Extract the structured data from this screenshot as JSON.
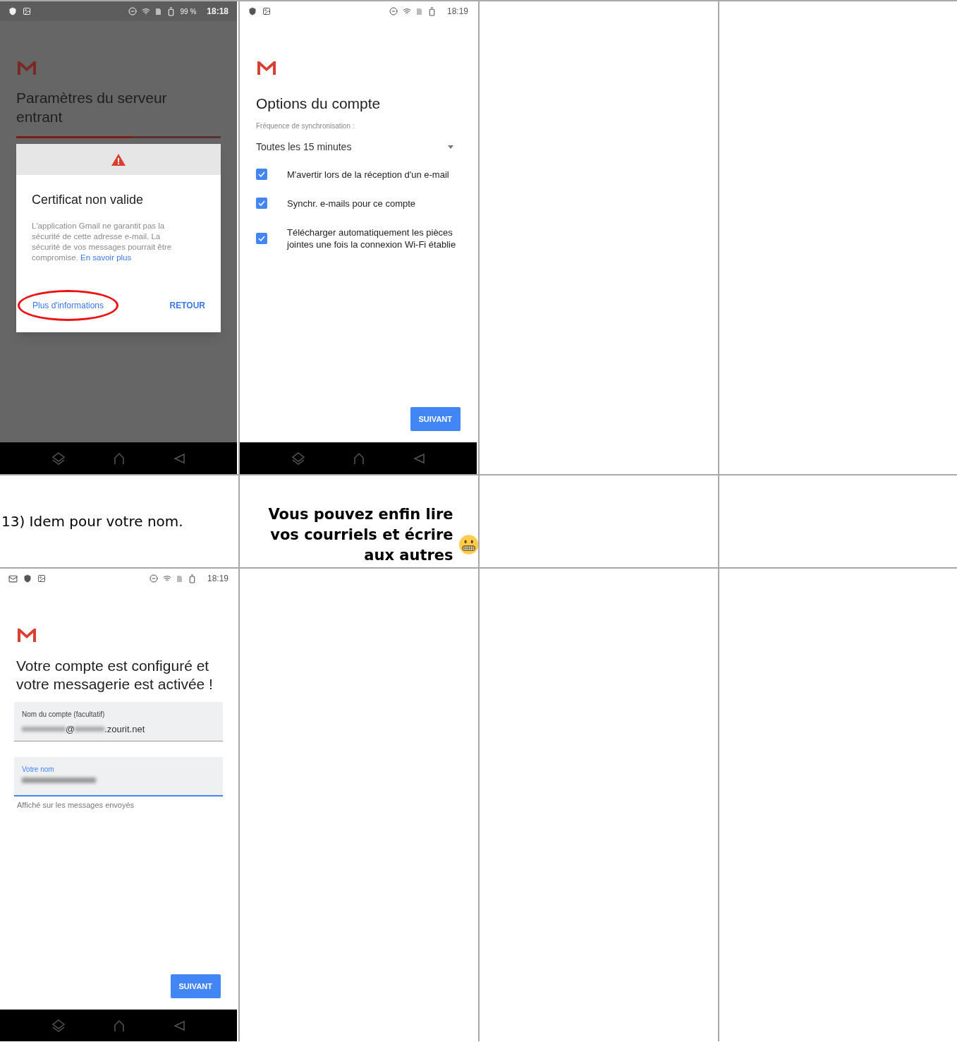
{
  "table": {
    "rows": [
      {
        "cells": [
          {
            "kind": "dialog_screen",
            "status_battery": "99 %",
            "status_time": "18:18",
            "title": "Paramètres du serveur entrant",
            "progress": {
              "level": 0.57
            },
            "dialog": {
              "title": "Certificat non valide",
              "body": "L'application Gmail ne garantit pas la sécurité de cette adresse e-mail. La sécurité de vos messages pourrait être compromise.",
              "link": "En savoir plus",
              "buttons": [
                {
                  "label": "Plus d'informations",
                  "highlighted": true
                },
                {
                  "label": "RETOUR",
                  "highlighted": false
                }
              ]
            }
          },
          {
            "kind": "options_screen",
            "status_time": "18:19",
            "title": "Options du compte",
            "sync_label": "Fréquence de synchronisation :",
            "sync_value": "Toutes les 15 minutes",
            "options": [
              {
                "label": "M'avertir lors de la réception d'un e-mail",
                "checked": true
              },
              {
                "label": "Synchr. e-mails pour ce compte",
                "checked": true
              },
              {
                "label": "Télécharger automatiquement les pièces jointes une fois la connexion Wi-Fi établie",
                "checked": true
              }
            ],
            "button": "SUIVANT"
          },
          {
            "kind": "empty"
          },
          {
            "kind": "empty"
          }
        ]
      },
      {
        "cells": [
          {
            "kind": "text",
            "text": "13) Idem pour votre nom."
          },
          {
            "kind": "caption",
            "text": "Vous pouvez enfin lire vos courriels et écrire aux autres"
          },
          {
            "kind": "empty"
          },
          {
            "kind": "empty"
          }
        ]
      },
      {
        "cells": [
          {
            "kind": "account_screen",
            "status_time": "18:19",
            "title": "Votre compte est configuré et votre messagerie est activée !",
            "fields": [
              {
                "label": "Nom du compte (facultatif)",
                "value_parts": [
                  "@",
                  ".zourit.net"
                ],
                "focused": false
              },
              {
                "label": "Votre nom",
                "focused": true,
                "helper": "Affiché sur les messages envoyés"
              }
            ],
            "button": "SUIVANT"
          },
          {
            "kind": "empty"
          },
          {
            "kind": "empty"
          },
          {
            "kind": "empty"
          }
        ]
      }
    ]
  }
}
